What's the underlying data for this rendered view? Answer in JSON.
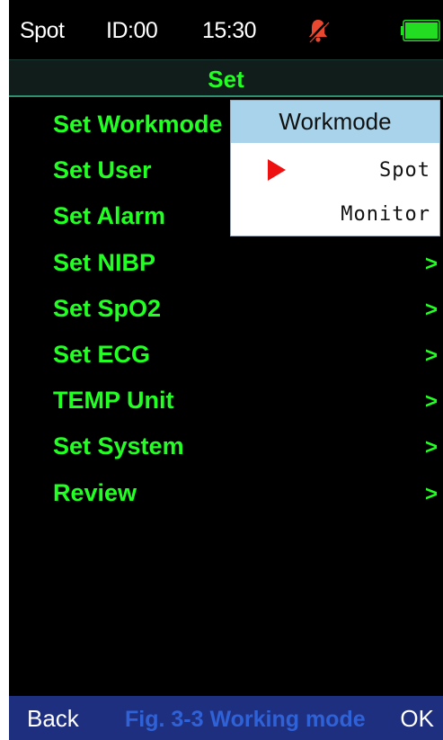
{
  "status_bar": {
    "mode": "Spot",
    "id": "ID:00",
    "time": "15:30",
    "alarm_icon": "bell-icon",
    "battery_icon": "battery-icon",
    "battery_level": 1.0,
    "battery_color": "#22dd22"
  },
  "title": "Set",
  "menu": {
    "items": [
      {
        "label": "Set Workmode",
        "arrow": ">"
      },
      {
        "label": "Set User",
        "arrow": ">"
      },
      {
        "label": "Set Alarm",
        "arrow": ">"
      },
      {
        "label": "Set NIBP",
        "arrow": ">"
      },
      {
        "label": "Set SpO2",
        "arrow": ">"
      },
      {
        "label": "Set ECG",
        "arrow": ">"
      },
      {
        "label": "TEMP Unit",
        "arrow": ">"
      },
      {
        "label": "Set System",
        "arrow": ">"
      },
      {
        "label": "Review",
        "arrow": ">"
      }
    ]
  },
  "popup": {
    "title": "Workmode",
    "options": [
      "Spot",
      "Monitor"
    ],
    "selected": "Spot",
    "marker_color": "#ee1111"
  },
  "bottom_bar": {
    "back_label": "Back",
    "ok_label": "OK"
  },
  "caption": "Fig. 3-3 Working mode",
  "colors": {
    "menu_text": "#22ff22",
    "background": "#000000",
    "popup_header": "#a9d3ea",
    "bottom_bar": "#1f2f80"
  }
}
